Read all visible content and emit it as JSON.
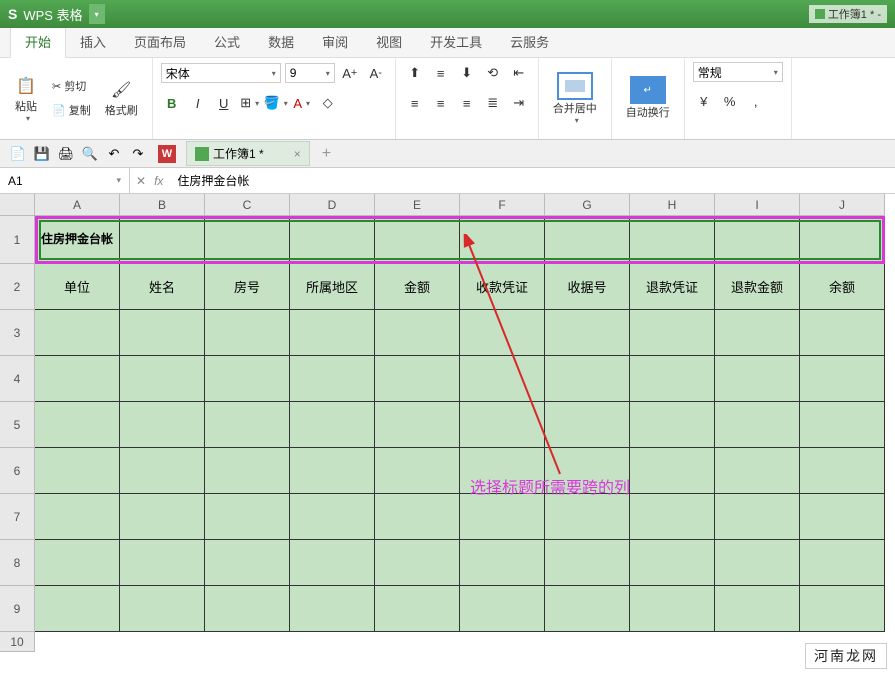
{
  "title_bar": {
    "logo": "S",
    "app": "WPS 表格",
    "workbook": "工作簿1 * -"
  },
  "menu": {
    "tabs": [
      "开始",
      "插入",
      "页面布局",
      "公式",
      "数据",
      "审阅",
      "视图",
      "开发工具",
      "云服务"
    ],
    "active": 0
  },
  "ribbon": {
    "clipboard": {
      "paste": "粘贴",
      "cut": "剪切",
      "copy": "复制",
      "format_painter": "格式刷"
    },
    "font": {
      "name": "宋体",
      "size": "9",
      "bold": "B",
      "italic": "I",
      "underline": "U"
    },
    "align": {
      "merge": "合并居中",
      "wrap": "自动换行"
    },
    "number": {
      "format": "常规",
      "currency": "¥",
      "percent": "%",
      "thousands": ","
    }
  },
  "quick_access": {
    "file_tab": "工作簿1 *"
  },
  "reference": {
    "cell": "A1",
    "formula": "住房押金台帐"
  },
  "sheet": {
    "columns": [
      "A",
      "B",
      "C",
      "D",
      "E",
      "F",
      "G",
      "H",
      "I",
      "J"
    ],
    "rows": [
      "1",
      "2",
      "3",
      "4",
      "5",
      "6",
      "7",
      "8",
      "9",
      "10"
    ],
    "title_cell": "住房押金台帐",
    "headers": [
      "单位",
      "姓名",
      "房号",
      "所属地区",
      "金额",
      "收款凭证",
      "收据号",
      "退款凭证",
      "退款金额",
      "余额"
    ]
  },
  "annotation": {
    "text": "选择标题所需要跨的列"
  },
  "watermark": "河南龙网"
}
